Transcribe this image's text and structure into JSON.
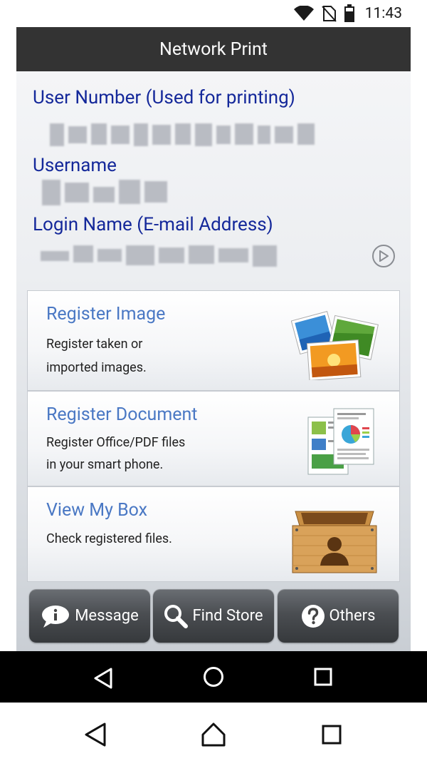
{
  "status_bar": {
    "time": "11:43"
  },
  "title": "Network Print",
  "user_info": {
    "user_number_label": "User Number (Used for printing)",
    "username_label": "Username",
    "login_name_label": "Login Name (E-mail Address)"
  },
  "cards": [
    {
      "title": "Register Image",
      "desc1": "Register taken or",
      "desc2": "imported images."
    },
    {
      "title": "Register Document",
      "desc1": "Register Office/PDF files",
      "desc2": "in your smart phone."
    },
    {
      "title": "View My Box",
      "desc1": "Check registered files."
    }
  ],
  "bottom_buttons": [
    {
      "label": "Message",
      "icon": "info-bubble-icon"
    },
    {
      "label": "Find Store",
      "icon": "search-icon"
    },
    {
      "label": "Others",
      "icon": "question-icon"
    }
  ],
  "colors": {
    "accent": "#14289a",
    "card_title": "#4a78c4",
    "title_bar": "#333333"
  }
}
